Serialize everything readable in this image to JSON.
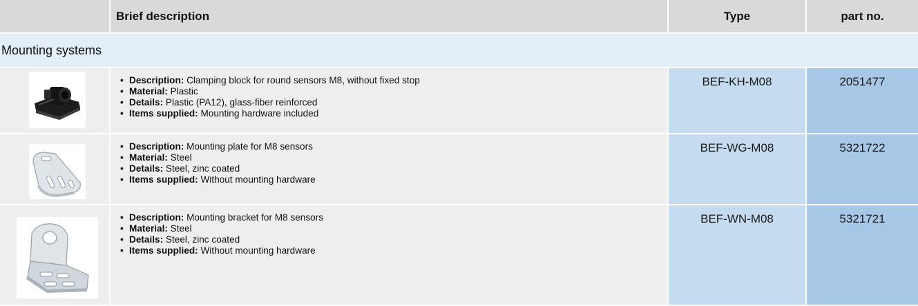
{
  "header": {
    "brief_description": "Brief description",
    "type": "Type",
    "part_no": "part no."
  },
  "section": {
    "title": "Mounting systems"
  },
  "rows": [
    {
      "image_icon": "clamping-block-photo",
      "bullets": [
        {
          "label": "Description:",
          "text": " Clamping block for round sensors M8, without fixed stop"
        },
        {
          "label": "Material:",
          "text": " Plastic"
        },
        {
          "label": "Details:",
          "text": " Plastic (PA12), glass-fiber reinforced"
        },
        {
          "label": "Items supplied:",
          "text": " Mounting hardware included"
        }
      ],
      "type": "BEF-KH-M08",
      "part_no": "2051477"
    },
    {
      "image_icon": "mounting-plate-photo",
      "bullets": [
        {
          "label": "Description:",
          "text": " Mounting plate for M8 sensors"
        },
        {
          "label": "Material:",
          "text": " Steel"
        },
        {
          "label": "Details:",
          "text": " Steel, zinc coated"
        },
        {
          "label": "Items supplied:",
          "text": " Without mounting hardware"
        }
      ],
      "type": "BEF-WG-M08",
      "part_no": "5321722"
    },
    {
      "image_icon": "mounting-bracket-photo",
      "bullets": [
        {
          "label": "Description:",
          "text": " Mounting bracket for M8 sensors"
        },
        {
          "label": "Material:",
          "text": " Steel"
        },
        {
          "label": "Details:",
          "text": " Steel, zinc coated"
        },
        {
          "label": "Items supplied:",
          "text": " Without mounting hardware"
        }
      ],
      "type": "BEF-WN-M08",
      "part_no": "5321721"
    }
  ],
  "colors": {
    "header_bg": "#d9d9d9",
    "section_bg": "#e2eef8",
    "row_bg": "#eeeeee",
    "type_bg": "#c5dbef",
    "part_bg": "#a6c8e6"
  }
}
